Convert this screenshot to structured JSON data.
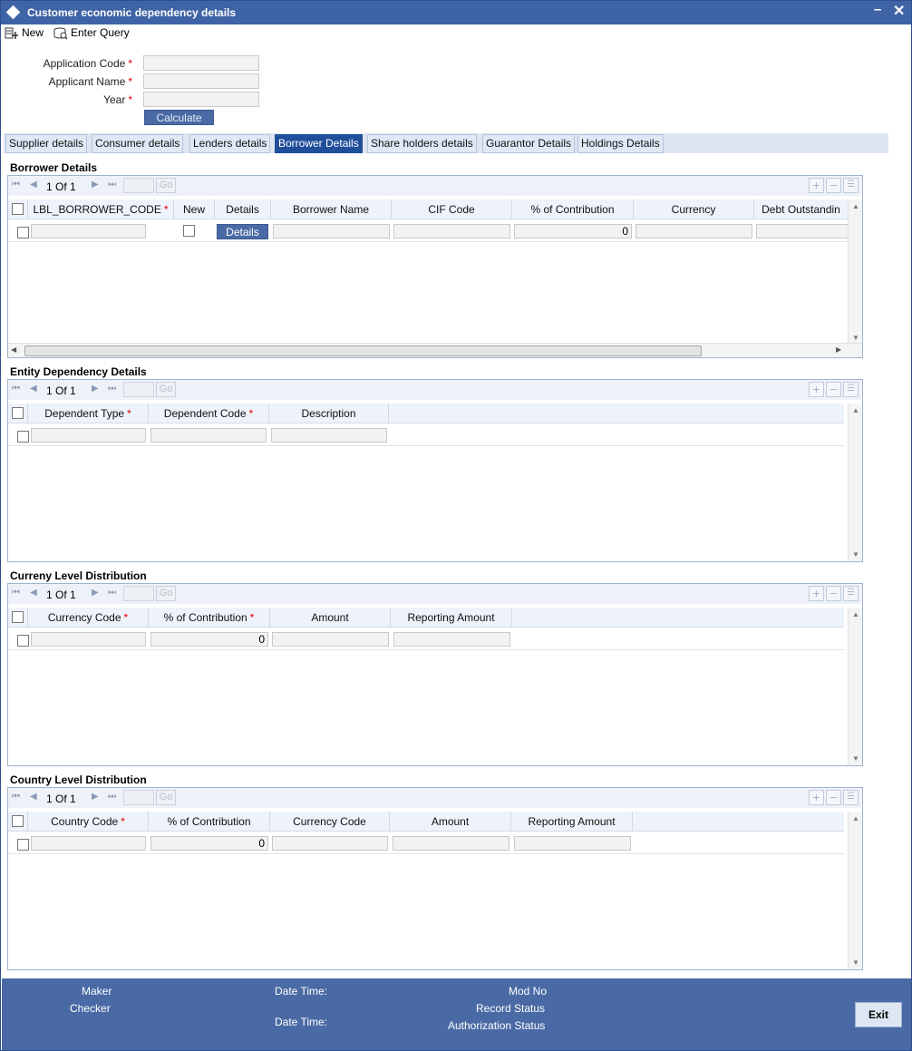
{
  "window": {
    "title": "Customer economic dependency details"
  },
  "toolbar": {
    "new_label": "New",
    "enter_query_label": "Enter Query"
  },
  "form": {
    "application_code_label": "Application Code",
    "applicant_name_label": "Applicant Name",
    "year_label": "Year",
    "required_mark": "*",
    "calculate_label": "Calculate"
  },
  "tabs": [
    {
      "label": "Supplier details"
    },
    {
      "label": "Consumer details"
    },
    {
      "label": "Lenders details"
    },
    {
      "label": "Borrower Details",
      "active": true
    },
    {
      "label": "Share holders details"
    },
    {
      "label": "Guarantor Details"
    },
    {
      "label": "Holdings Details"
    }
  ],
  "pager": {
    "page": "1",
    "of_label": "Of",
    "total": "1",
    "go_label": "Go"
  },
  "borrower": {
    "title": "Borrower Details",
    "columns": [
      "LBL_BORROWER_CODE",
      "New",
      "Details",
      "Borrower Name",
      "CIF Code",
      "% of Contribution",
      "Currency",
      "Debt Outstandin"
    ],
    "row": {
      "details_button": "Details",
      "contribution": "0"
    }
  },
  "entity": {
    "title": "Entity Dependency Details",
    "columns": [
      "Dependent Type",
      "Dependent Code",
      "Description"
    ]
  },
  "currency": {
    "title": "Curreny Level Distribution",
    "columns": [
      "Currency Code",
      "% of Contribution",
      "Amount",
      "Reporting Amount"
    ],
    "row": {
      "contribution": "0"
    }
  },
  "country": {
    "title": "Country Level Distribution",
    "columns": [
      "Country Code",
      "% of Contribution",
      "Currency Code",
      "Amount",
      "Reporting Amount"
    ],
    "row": {
      "contribution": "0"
    }
  },
  "footer": {
    "maker": "Maker",
    "checker": "Checker",
    "date_time": "Date Time:",
    "mod_no": "Mod No",
    "record_status": "Record Status",
    "authorization_status": "Authorization Status",
    "exit_label": "Exit"
  },
  "colors": {
    "titlebar": "#3f64a6",
    "active_tab": "#1f4e9a",
    "footer": "#4a6aa5",
    "required": "#dd0000"
  }
}
